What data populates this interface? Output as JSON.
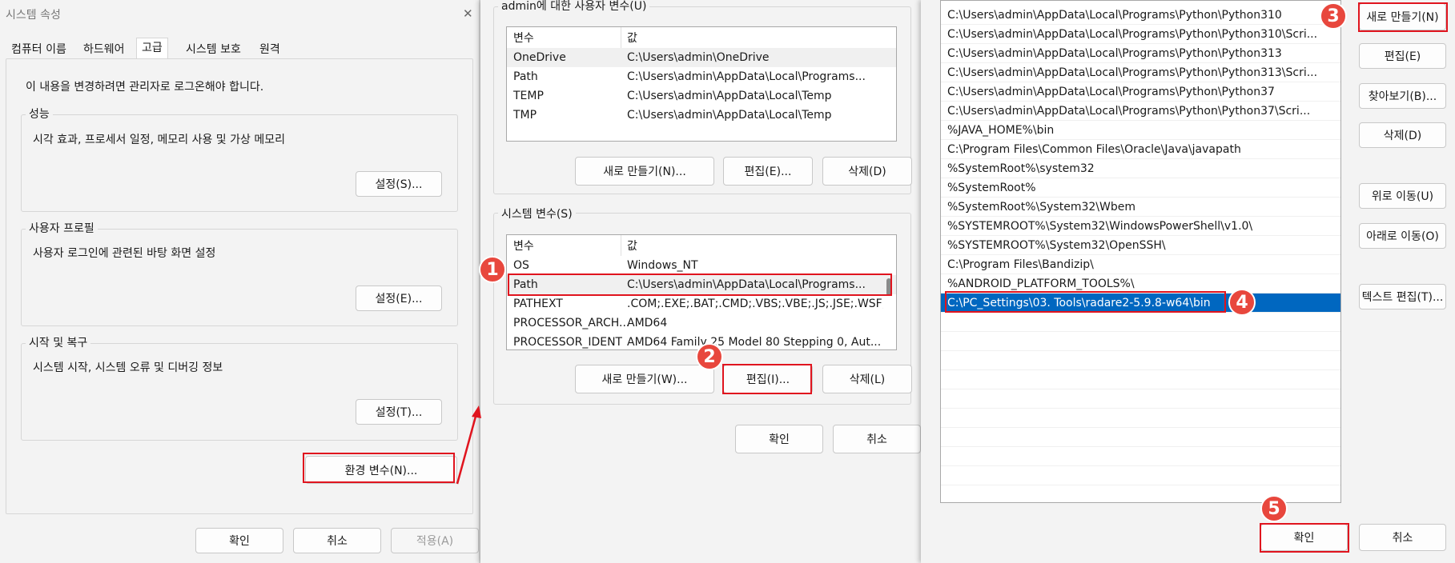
{
  "sysprop": {
    "title": "시스템 속성",
    "close": "✕",
    "tabs": [
      "컴퓨터 이름",
      "하드웨어",
      "고급",
      "시스템 보호",
      "원격"
    ],
    "admin_note": "이 내용을 변경하려면 관리자로 로그온해야 합니다.",
    "performance": {
      "label": "성능",
      "desc": "시각 효과, 프로세서 일정, 메모리 사용 및 가상 메모리",
      "button": "설정(S)..."
    },
    "profile": {
      "label": "사용자 프로필",
      "desc": "사용자 로그인에 관련된 바탕 화면 설정",
      "button": "설정(E)..."
    },
    "startup": {
      "label": "시작 및 복구",
      "desc": "시스템 시작, 시스템 오류 및 디버깅 정보",
      "button": "설정(T)..."
    },
    "env_button": "환경 변수(N)...",
    "ok": "확인",
    "cancel": "취소",
    "apply": "적용(A)"
  },
  "envvars": {
    "user_label": "admin에 대한 사용자 변수(U)",
    "headers": [
      "변수",
      "값"
    ],
    "user_rows": [
      [
        "OneDrive",
        "C:\\Users\\admin\\OneDrive"
      ],
      [
        "Path",
        "C:\\Users\\admin\\AppData\\Local\\Programs..."
      ],
      [
        "TEMP",
        "C:\\Users\\admin\\AppData\\Local\\Temp"
      ],
      [
        "TMP",
        "C:\\Users\\admin\\AppData\\Local\\Temp"
      ]
    ],
    "user_buttons": [
      "새로 만들기(N)...",
      "편집(E)...",
      "삭제(D)"
    ],
    "system_label": "시스템 변수(S)",
    "system_rows": [
      [
        "OS",
        "Windows_NT"
      ],
      [
        "Path",
        "C:\\Users\\admin\\AppData\\Local\\Programs..."
      ],
      [
        "PATHEXT",
        ".COM;.EXE;.BAT;.CMD;.VBS;.VBE;.JS;.JSE;.WSF;..."
      ],
      [
        "PROCESSOR_ARCH...",
        "AMD64"
      ],
      [
        "PROCESSOR_IDENT...",
        "AMD64 Family 25 Model 80 Stepping 0, Aut..."
      ]
    ],
    "system_buttons": [
      "새로 만들기(W)...",
      "편집(I)...",
      "삭제(L)"
    ],
    "ok": "확인",
    "cancel": "취소"
  },
  "editpath": {
    "entries": [
      "C:\\Users\\admin\\AppData\\Local\\Programs\\Python\\Python310",
      "C:\\Users\\admin\\AppData\\Local\\Programs\\Python\\Python310\\Scri...",
      "C:\\Users\\admin\\AppData\\Local\\Programs\\Python\\Python313",
      "C:\\Users\\admin\\AppData\\Local\\Programs\\Python\\Python313\\Scri...",
      "C:\\Users\\admin\\AppData\\Local\\Programs\\Python\\Python37",
      "C:\\Users\\admin\\AppData\\Local\\Programs\\Python\\Python37\\Scri...",
      "%JAVA_HOME%\\bin",
      "C:\\Program Files\\Common Files\\Oracle\\Java\\javapath",
      "%SystemRoot%\\system32",
      "%SystemRoot%",
      "%SystemRoot%\\System32\\Wbem",
      "%SYSTEMROOT%\\System32\\WindowsPowerShell\\v1.0\\",
      "%SYSTEMROOT%\\System32\\OpenSSH\\",
      "C:\\Program Files\\Bandizip\\",
      "%ANDROID_PLATFORM_TOOLS%\\",
      "C:\\PC_Settings\\03. Tools\\radare2-5.9.8-w64\\bin"
    ],
    "buttons": {
      "new": "새로 만들기(N)",
      "edit": "편집(E)",
      "browse": "찾아보기(B)...",
      "delete": "삭제(D)",
      "up": "위로 이동(U)",
      "down": "아래로 이동(O)",
      "text_edit": "텍스트 편집(T)..."
    },
    "ok": "확인",
    "cancel": "취소"
  },
  "annotations": [
    "1",
    "2",
    "3",
    "4",
    "5"
  ],
  "colors": {
    "annotation_red": "#e0141e",
    "selection_blue": "#0067c0"
  }
}
